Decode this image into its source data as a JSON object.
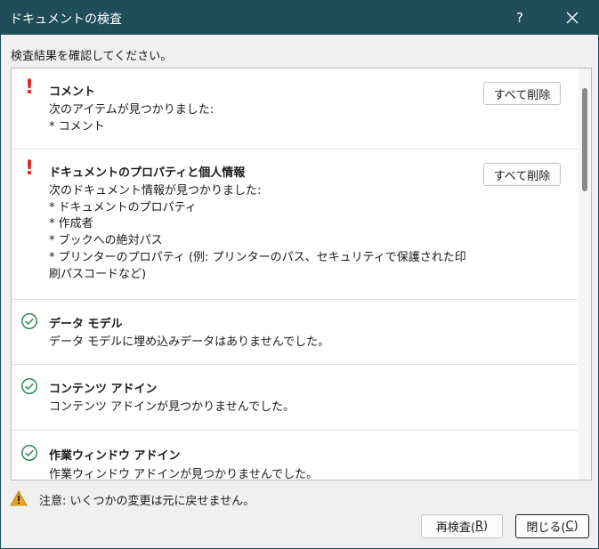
{
  "window": {
    "title": "ドキュメントの検査",
    "help_label": "?"
  },
  "instruction": "検査結果を確認してください。",
  "sections": [
    {
      "title": "コメント",
      "status": "warning",
      "lines": [
        "次のアイテムが見つかりました:",
        "* コメント"
      ],
      "button": "すべて削除"
    },
    {
      "title": "ドキュメントのプロパティと個人情報",
      "status": "warning",
      "lines": [
        "次のドキュメント情報が見つかりました:",
        "* ドキュメントのプロパティ",
        "* 作成者",
        "* ブックへの絶対パス",
        "* プリンターのプロパティ (例: プリンターのパス、セキュリティで保護された印刷パスコードなど)"
      ],
      "button": "すべて削除"
    },
    {
      "title": "データ モデル",
      "status": "ok",
      "lines": [
        "データ モデルに埋め込みデータはありませんでした。"
      ]
    },
    {
      "title": "コンテンツ アドイン",
      "status": "ok",
      "lines": [
        "コンテンツ アドインが見つかりませんでした。"
      ]
    },
    {
      "title": "作業ウィンドウ アドイン",
      "status": "ok",
      "lines": [
        "作業ウィンドウ アドインが見つかりませんでした。"
      ]
    }
  ],
  "footer": {
    "note": "注意: いくつかの変更は元に戻せません。",
    "reinspect": {
      "text": "再検査(",
      "key": "R",
      "end": ")"
    },
    "close": {
      "text": "閉じる(",
      "key": "C",
      "end": ")"
    }
  },
  "colors": {
    "titlebar": "#1f4e59",
    "warning": "#d52b1e",
    "ok": "#2e8b57",
    "caution": "#e8a317"
  },
  "icons": {
    "warning": "exclamation-mark",
    "ok": "check-circle",
    "caution": "warning-triangle"
  }
}
